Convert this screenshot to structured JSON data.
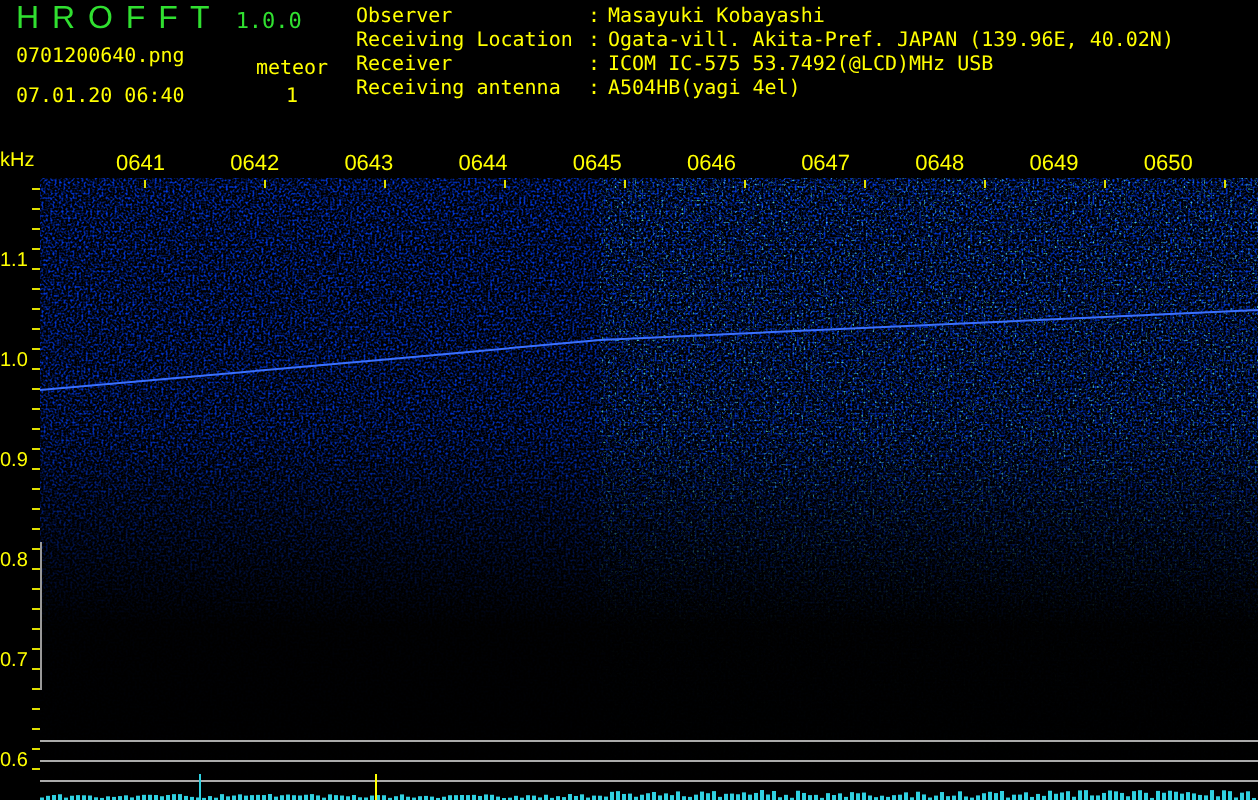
{
  "header": {
    "program_title": "H R O F F T",
    "version": "1.0.0",
    "filename": "0701200640.png",
    "timestamp": "07.01.20 06:40",
    "meteor_label": "meteor",
    "meteor_count": "1"
  },
  "station_info": [
    {
      "label": "Observer",
      "separator": ":",
      "value": "Masayuki Kobayashi"
    },
    {
      "label": "Receiving Location",
      "separator": ":",
      "value": "Ogata-vill. Akita-Pref. JAPAN (139.96E, 40.02N)"
    },
    {
      "label": "Receiver",
      "separator": ":",
      "value": "ICOM IC-575 53.7492(@LCD)MHz USB"
    },
    {
      "label": "Receiving antenna",
      "separator": ":",
      "value": "A504HB(yagi 4el)"
    }
  ],
  "spectrogram": {
    "unit": "kHz",
    "frequency_labels": [
      "1.1",
      "1.0",
      "0.9",
      "0.8",
      "0.7",
      "0.6"
    ],
    "time_labels": [
      "0641",
      "0642",
      "0643",
      "0644",
      "0645",
      "0646",
      "0647",
      "0648",
      "0649",
      "0650"
    ]
  }
}
